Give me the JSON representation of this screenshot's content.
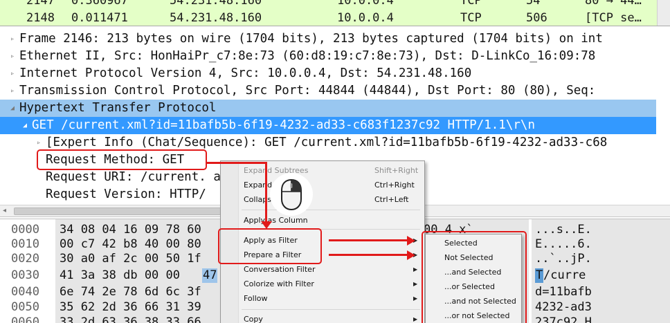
{
  "packet_list": {
    "rows": [
      {
        "no": "2147",
        "time": "0.360967",
        "src": "54.231.48.160",
        "dst": "10.0.0.4",
        "proto": "TCP",
        "len": "54",
        "info": "80 → 44…"
      },
      {
        "no": "2148",
        "time": "0.011471",
        "src": "54.231.48.160",
        "dst": "10.0.0.4",
        "proto": "TCP",
        "len": "506",
        "info": "[TCP se…"
      }
    ]
  },
  "details": {
    "rows": [
      {
        "expander": "▹",
        "text": "Frame 2146: 213 bytes on wire (1704 bits), 213 bytes captured (1704 bits) on int"
      },
      {
        "expander": "▹",
        "text": "Ethernet II, Src: HonHaiPr_c7:8e:73 (60:d8:19:c7:8e:73), Dst: D-LinkCo_16:09:78"
      },
      {
        "expander": "▹",
        "text": "Internet Protocol Version 4, Src: 10.0.0.4, Dst: 54.231.48.160"
      },
      {
        "expander": "▹",
        "text": "Transmission Control Protocol, Src Port: 44844 (44844), Dst Port: 80 (80), Seq:"
      },
      {
        "expander": "◢",
        "text": "Hypertext Transfer Protocol"
      },
      {
        "expander": "◢",
        "text": "GET /current.xml?id=11bafb5b-6f19-4232-ad33-c683f1237c92 HTTP/1.1\\r\\n"
      },
      {
        "expander": "▹",
        "text": "[Expert Info (Chat/Sequence): GET /current.xml?id=11bafb5b-6f19-4232-ad33-c68"
      },
      {
        "expander": "",
        "text": "Request Method: GET"
      },
      {
        "expander": "",
        "text": "Request URI: /current.                                  ad33-c683f1237c92"
      },
      {
        "expander": "",
        "text": "Request Version: HTTP/"
      }
    ]
  },
  "bytes": {
    "rows": [
      {
        "offset": "0000",
        "hex": "34 08 04 16 09 78 60",
        "hex_tail": "00   4    x`",
        "ascii": "...s..E."
      },
      {
        "offset": "0010",
        "hex": "00 c7 42 b8 40 00 80",
        "hex_tail": "",
        "ascii": "E.....6."
      },
      {
        "offset": "0020",
        "hex": "30 a0 af 2c 00 50 1f",
        "hex_tail": "",
        "ascii": "..`..jP."
      },
      {
        "offset": "0030",
        "hex": "41 3a 38 db 00 00",
        "hex_sel": "47",
        "hex_tail": "",
        "ascii_sel": "T",
        "ascii": " /curre"
      },
      {
        "offset": "0040",
        "hex": "6e 74 2e 78 6d 6c 3f",
        "hex_tail": "",
        "ascii": "d=11bafb"
      },
      {
        "offset": "0050",
        "hex": "35 62 2d 36 66 31 39",
        "hex_tail": "",
        "ascii": "4232-ad3"
      },
      {
        "offset": "0060",
        "hex": "33 2d 63 36 38 33 66",
        "hex_tail": "",
        "ascii": "237c92 H"
      }
    ]
  },
  "context_menu": {
    "items": [
      {
        "label": "Expand Subtrees",
        "shortcut": "Shift+Right",
        "disabled": true
      },
      {
        "label": "Expand All",
        "shortcut": "Ctrl+Right"
      },
      {
        "label": "Collapse All",
        "shortcut": "Ctrl+Left"
      },
      {
        "label": "Apply as Column",
        "shortcut": ""
      },
      {
        "label": "Apply as Filter",
        "shortcut": "",
        "submenu": true
      },
      {
        "label": "Prepare a Filter",
        "shortcut": "",
        "submenu": true
      },
      {
        "label": "Conversation Filter",
        "shortcut": "",
        "submenu": true
      },
      {
        "label": "Colorize with Filter",
        "shortcut": "",
        "submenu": true
      },
      {
        "label": "Follow",
        "shortcut": "",
        "submenu": true
      },
      {
        "label": "Copy",
        "shortcut": "",
        "submenu": true
      }
    ]
  },
  "submenu": {
    "items": [
      "Selected",
      "Not Selected",
      "...and Selected",
      "...or Selected",
      "...and not Selected",
      "...or not Selected"
    ]
  },
  "colors": {
    "packet_list_bg": "#e4ffc7",
    "selection": "#99c7f0",
    "selection_strong": "#3399ff",
    "annotation": "#e11a1a"
  },
  "icons": {
    "mouse": "mouse-right-click-icon",
    "expander_closed": "triangle-right-icon",
    "expander_open": "triangle-down-icon",
    "submenu_arrow": "triangle-right-icon"
  }
}
